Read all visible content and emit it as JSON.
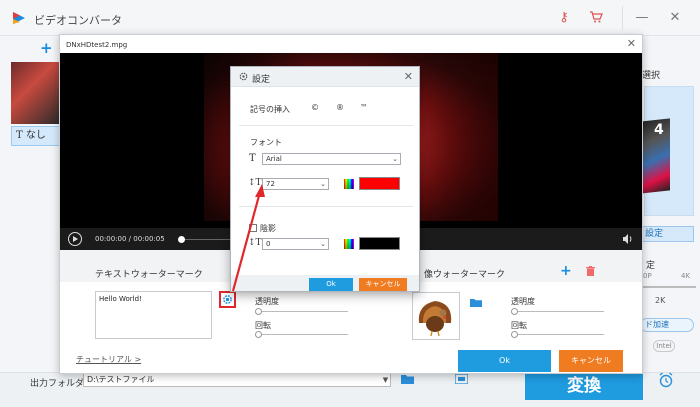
{
  "app": {
    "title": "ビデオコンバータ",
    "left_item_label": "なし",
    "right_selection_label": "選択",
    "right_thumb_number": "4",
    "right_setting_label": "設定",
    "right_quality_label": "定",
    "right_bp": "0P",
    "right_k_top": "4K",
    "right_k_value": "2K",
    "right_accel_label": "ド加速",
    "right_intel_label": "Intel",
    "output_folder_label": "出力フォルダ：",
    "output_folder_value": "D:\\テストファイル",
    "convert_label": "変換",
    "brand_color": "#1f9be0"
  },
  "editor": {
    "file_name": "DNxHDtest2.mpg",
    "time_current": "00:00:00",
    "time_separator": " / ",
    "time_total": "00:00:05",
    "playback_progress": 0,
    "text_watermark_title": "テキストウォーターマーク",
    "image_watermark_title": "像ウォーターマーク",
    "watermark_text": "Hello World!",
    "transparency_label": "透明度",
    "rotation_label": "回転",
    "transparency_label_2": "透明度",
    "rotation_label_2": "回転",
    "tutorial_link": "チュートリアル >",
    "ok_label": "Ok",
    "cancel_label": "キャンセル"
  },
  "settings_popup": {
    "title": "設定",
    "symbol_insert_label": "記号の挿入",
    "symbols": [
      "©",
      "®",
      "™"
    ],
    "font_section_label": "フォント",
    "font_family_value": "Arial",
    "font_size_value": "72",
    "font_color": "#ff0000",
    "shadow_label": "陰影",
    "shadow_checked": false,
    "shadow_value": "0",
    "shadow_color": "#000000",
    "ok_label": "Ok",
    "cancel_label": "キャンセル"
  }
}
